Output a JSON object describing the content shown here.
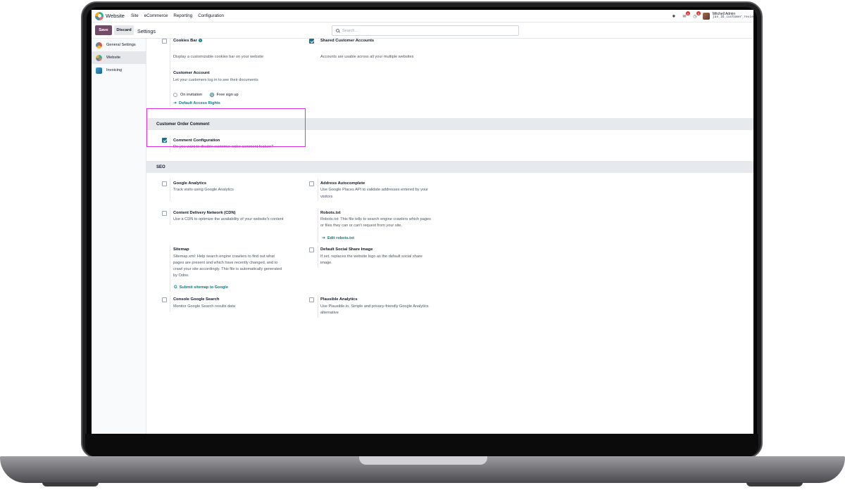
{
  "navbar": {
    "app_name": "Website",
    "menu": [
      "Site",
      "eCommerce",
      "Reporting",
      "Configuration"
    ],
    "messages_badge": "9",
    "activities_badge": "5",
    "user_name": "Mitchell Admin",
    "database": "jan_16_customer_revie"
  },
  "control_panel": {
    "save_label": "Save",
    "discard_label": "Discard",
    "title": "Settings",
    "search_placeholder": "Search..."
  },
  "sidebar": {
    "items": [
      {
        "label": "General Settings",
        "icon": "general-settings-icon",
        "active": false
      },
      {
        "label": "Website",
        "icon": "website-app-icon",
        "active": true
      },
      {
        "label": "Invoicing",
        "icon": "invoicing-app-icon",
        "active": false
      }
    ]
  },
  "top_section": {
    "cookies_bar": {
      "title": "Cookies Bar",
      "description": "Display a customizable cookies bar on your website",
      "checked": false
    },
    "shared_accounts": {
      "title": "Shared Customer Accounts",
      "description": "Accounts are usable across all your multiple websites",
      "checked": true
    },
    "customer_account": {
      "title": "Customer Account",
      "description": "Let your customers log in to see their documents",
      "options": [
        "On invitation",
        "Free sign up"
      ],
      "selected": "Free sign up",
      "link": "Default Access Rights"
    }
  },
  "customer_order_comment": {
    "header": "Customer Order Comment",
    "setting": {
      "title": "Comment Configuration",
      "description": "Do you want to disable customer order comment feature?",
      "checked": true
    }
  },
  "seo": {
    "header": "SEO",
    "google_analytics": {
      "title": "Google Analytics",
      "description": "Track visits using Google Analytics",
      "checked": false
    },
    "address_autocomplete": {
      "title": "Address Autocomplete",
      "description_1": "Use Google Places API to validate addresses entered by your",
      "description_2": "visitors",
      "checked": false
    },
    "cdn": {
      "title": "Content Delivery Network (CDN)",
      "description": "Use a CDN to optimize the availability of your website's content",
      "checked": false
    },
    "robots": {
      "title": "Robots.txt",
      "description_1": "Robots.txt: This file tells to search engine crawlers which pages",
      "description_2": "or files they can or can't request from your site.",
      "link": "Edit robots.txt"
    },
    "sitemap": {
      "title": "Sitemap",
      "description_1": "Sitemap.xml: Help search engine crawlers to find out what",
      "description_2": "pages are present and which have recently changed, and to",
      "description_3": "crawl your site accordingly. This file is automatically generated",
      "description_4": "by Odoo.",
      "link": "Submit sitemap to Google"
    },
    "social_share": {
      "title": "Default Social Share Image",
      "description_1": "If set, replaces the website logo as the default social share",
      "description_2": "image.",
      "checked": false
    },
    "console_search": {
      "title": "Console Google Search",
      "description": "Monitor Google Search results data",
      "checked": false
    },
    "plausible": {
      "title": "Plausible Analytics",
      "description_1": "Use Plausible.io, Simple and privacy-friendly Google Analytics",
      "description_2": "alternative",
      "checked": false
    }
  },
  "colors": {
    "brand": "#714b67",
    "accent": "#017e84",
    "highlight": "#e02fe0"
  }
}
